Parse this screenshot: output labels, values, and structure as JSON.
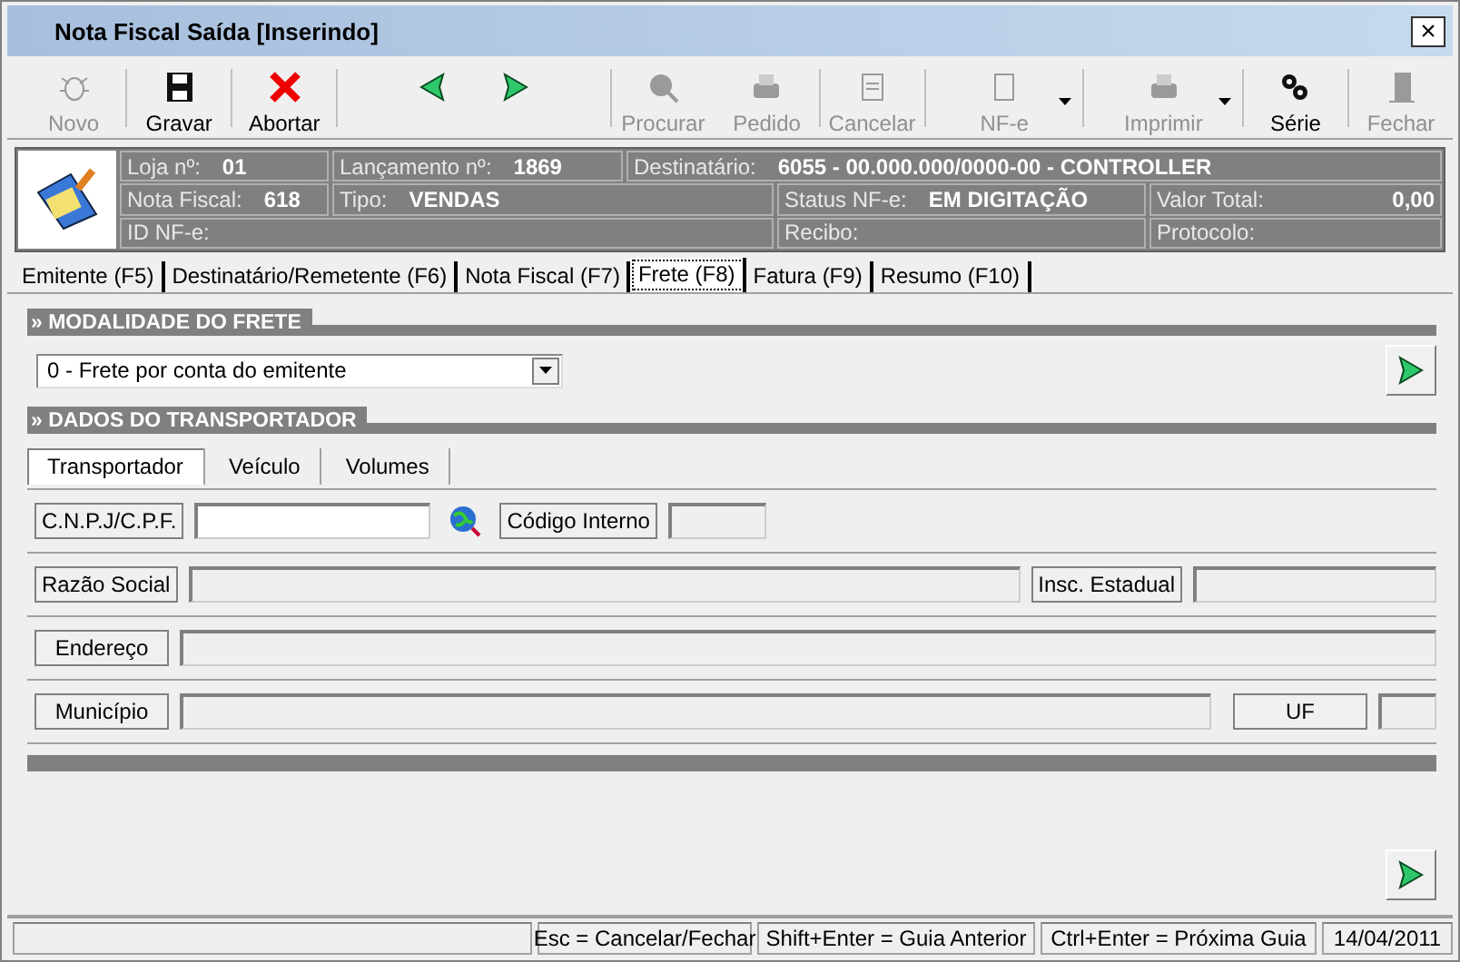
{
  "window": {
    "title": "Nota Fiscal Saída [Inserindo]",
    "close": "×"
  },
  "toolbar": [
    {
      "kind": "new",
      "label": "Novo",
      "disabled": true
    },
    {
      "kind": "save",
      "label": "Gravar",
      "disabled": false
    },
    {
      "kind": "abort",
      "label": "Abortar",
      "disabled": false
    },
    {
      "kind": "prev"
    },
    {
      "kind": "next"
    },
    {
      "kind": "search",
      "label": "Procurar",
      "disabled": true
    },
    {
      "kind": "order",
      "label": "Pedido",
      "disabled": true
    },
    {
      "kind": "cancel",
      "label": "Cancelar",
      "disabled": true
    },
    {
      "kind": "nfe",
      "label": "NF-e",
      "disabled": true,
      "dropdown": true
    },
    {
      "kind": "print",
      "label": "Imprimir",
      "disabled": true,
      "dropdown": true
    },
    {
      "kind": "serie",
      "label": "Série",
      "disabled": false
    },
    {
      "kind": "close",
      "label": "Fechar",
      "disabled": true
    }
  ],
  "header": {
    "fields": [
      {
        "label": "Loja nº:",
        "value": "01"
      },
      {
        "label": "Lançamento nº:",
        "value": "1869"
      },
      {
        "label": "Destinatário:",
        "value": "6055 - 00.000.000/0000-00 - CONTROLLER"
      },
      {
        "label": "Nota Fiscal:",
        "value": "618"
      },
      {
        "label": "Tipo:",
        "value": "VENDAS"
      },
      {
        "label": "Status NF-e:",
        "value": "EM DIGITAÇÃO"
      },
      {
        "label": "Valor Total:",
        "value": "0,00"
      },
      {
        "label": "ID NF-e:"
      },
      {
        "label": "Recibo:"
      },
      {
        "label": "Protocolo:"
      }
    ]
  },
  "tabs": [
    {
      "label": "Emitente (F5)",
      "selected": false
    },
    {
      "label": "Destinatário/Remetente (F6)",
      "selected": false
    },
    {
      "label": "Nota Fiscal (F7)",
      "selected": false
    },
    {
      "label": "Frete (F8)",
      "selected": true
    },
    {
      "label": "Fatura (F9)",
      "selected": false
    },
    {
      "label": "Resumo (F10)",
      "selected": false
    }
  ],
  "modalidade": {
    "heading": "» MODALIDADE DO FRETE",
    "value": "0 - Frete por conta do emitente"
  },
  "transportador": {
    "heading": "» DADOS DO TRANSPORTADOR",
    "subtabs": [
      {
        "label": "Transportador",
        "selected": true
      },
      {
        "label": "Veículo",
        "selected": false
      },
      {
        "label": "Volumes",
        "selected": false
      }
    ],
    "rows": [
      [
        {
          "kind": "label",
          "text": "C.N.P.J/C.P.F."
        },
        {
          "kind": "input",
          "enabled": true
        },
        {
          "kind": "lookup"
        },
        {
          "kind": "label",
          "text": "Código Interno"
        },
        {
          "kind": "input",
          "enabled": false
        }
      ],
      [
        {
          "kind": "label",
          "text": "Razão Social"
        },
        {
          "kind": "input",
          "enabled": false
        },
        {
          "kind": "label",
          "text": "Insc. Estadual"
        },
        {
          "kind": "input",
          "enabled": false
        }
      ],
      [
        {
          "kind": "label",
          "text": "Endereço"
        },
        {
          "kind": "input",
          "enabled": false
        }
      ],
      [
        {
          "kind": "label",
          "text": "Município"
        },
        {
          "kind": "input",
          "enabled": false
        },
        {
          "kind": "wide-label",
          "text": "UF"
        },
        {
          "kind": "input",
          "enabled": false
        }
      ]
    ]
  },
  "status_bar": [
    "Esc = Cancelar/Fechar",
    "Shift+Enter = Guia Anterior",
    "Ctrl+Enter = Próxima Guia",
    "14/04/2011"
  ]
}
